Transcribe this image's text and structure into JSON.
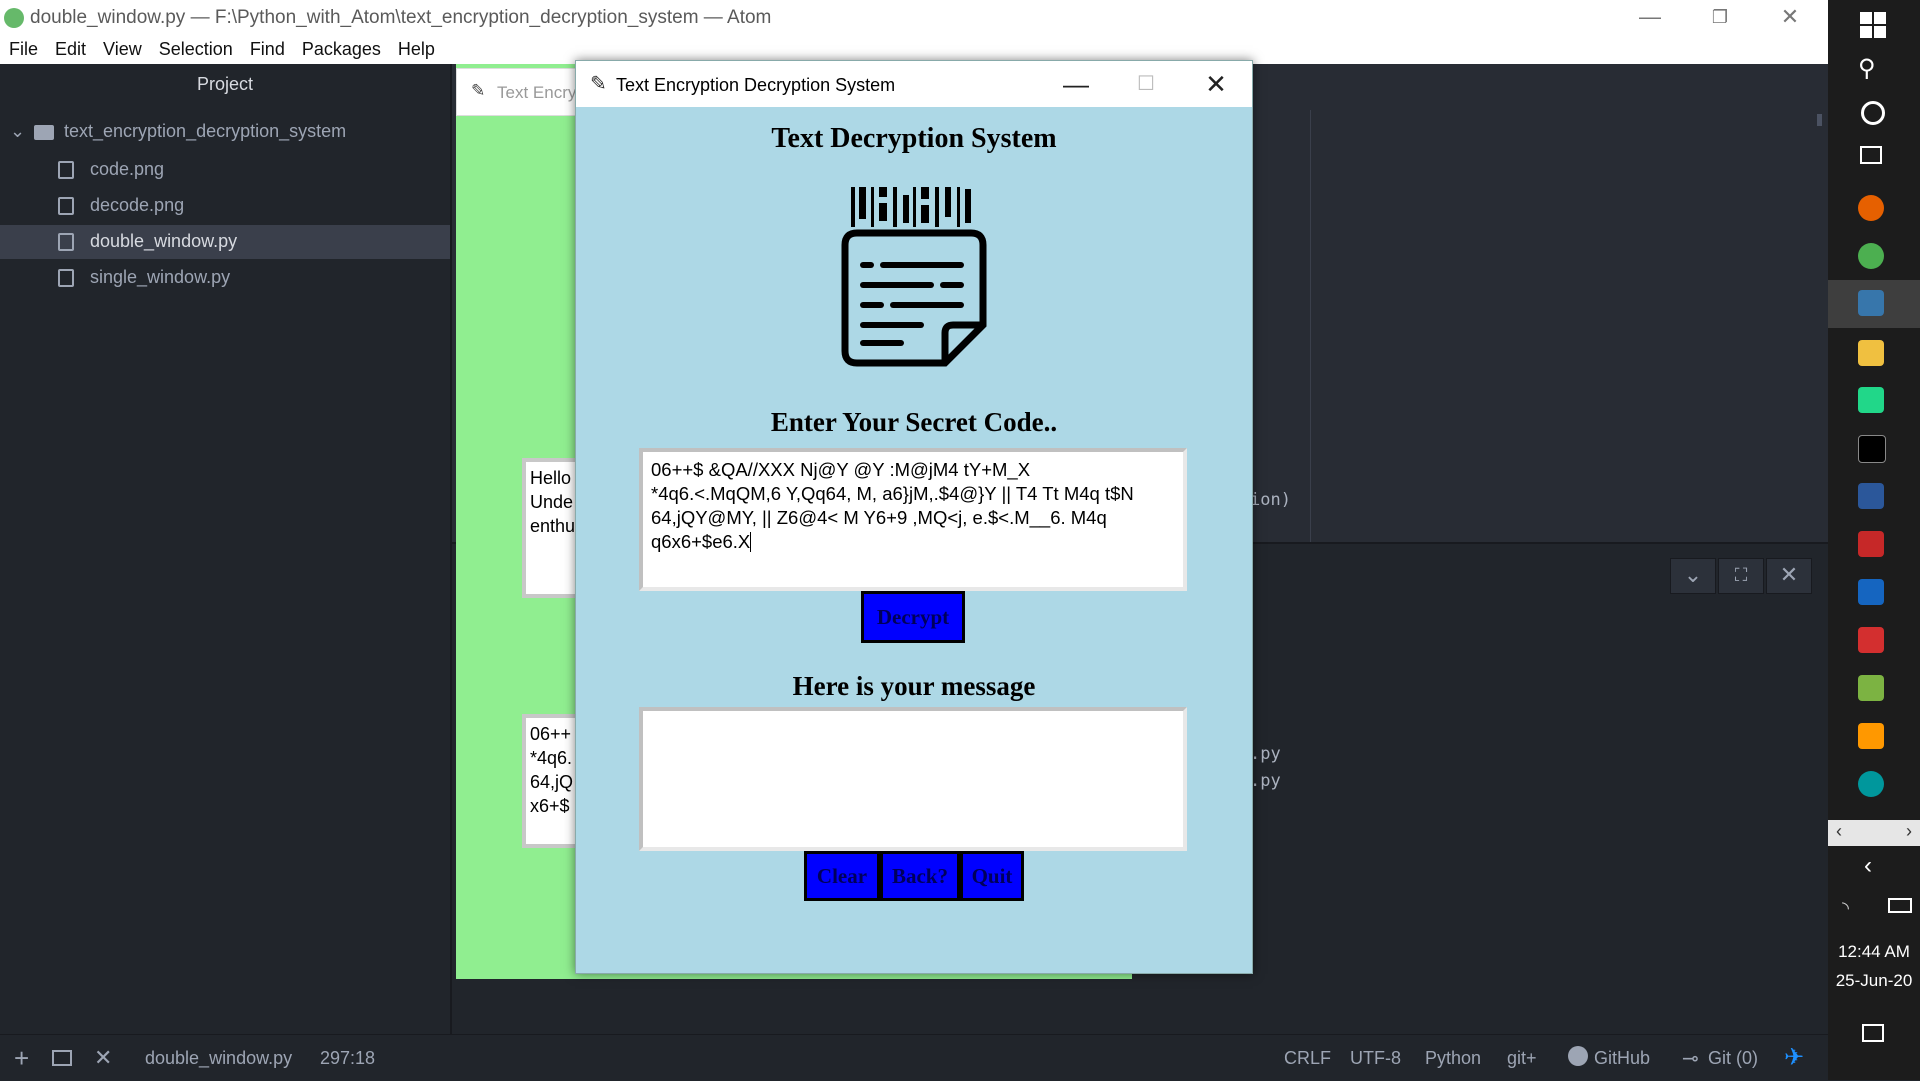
{
  "atom": {
    "window_title": "double_window.py — F:\\Python_with_Atom\\text_encryption_decryption_system — Atom",
    "menu": [
      "File",
      "Edit",
      "View",
      "Selection",
      "Find",
      "Packages",
      "Help"
    ],
    "project_header": "Project",
    "tree": [
      {
        "label": "text_encryption_decryption_system",
        "kind": "folder"
      },
      {
        "label": "code.png",
        "kind": "image"
      },
      {
        "label": "decode.png",
        "kind": "image"
      },
      {
        "label": "double_window.py",
        "kind": "file",
        "selected": true
      },
      {
        "label": "single_window.py",
        "kind": "file"
      }
    ],
    "editor_tab_partial": "Text Encry",
    "code_fragments": [
      "ion)",
      ".py",
      ".py"
    ],
    "statusbar": {
      "file": "double_window.py",
      "cursor": "297:18",
      "line_ending": "CRLF",
      "encoding": "UTF-8",
      "grammar": "Python",
      "git_plus": "git+",
      "github": "GitHub",
      "git": "Git (0)"
    }
  },
  "background_window": {
    "box1_lines": [
      "Hello",
      "Unde",
      "enthu"
    ],
    "box2_lines": [
      "06++",
      "*4q6.",
      "64,jQ",
      "x6+$"
    ]
  },
  "dialog": {
    "title": "Text Encryption Decryption System",
    "heading": "Text Decryption System",
    "icon": "document-barcode-icon",
    "prompt": "Enter Your Secret Code..",
    "code_lines": [
      "06++$ &QA//XXX Nj@Y @Y :M@jM4 tY+M_X",
      "*4q6.<.MqQM,6 Y,Qq64, M, a6}jM,.$4@}Y || T4 Tt M4q t$N",
      "64,jQY@MY, || Z6@4< M Y6+9 ,MQ<j, e.$<.M__6. M4q",
      "q6x6+$e6.X"
    ],
    "decrypt_label": "Decrypt",
    "message_label": "Here is your message",
    "message_value": "",
    "clear_label": "Clear",
    "back_label": "Back?",
    "quit_label": "Quit"
  },
  "taskbar": {
    "time": "12:44 AM",
    "date": "25-Jun-20"
  },
  "colors": {
    "dialog_bg": "#add8e6",
    "green_window_bg": "#90ee90",
    "button_blue": "#0000ff",
    "atom_bg": "#21252b"
  }
}
